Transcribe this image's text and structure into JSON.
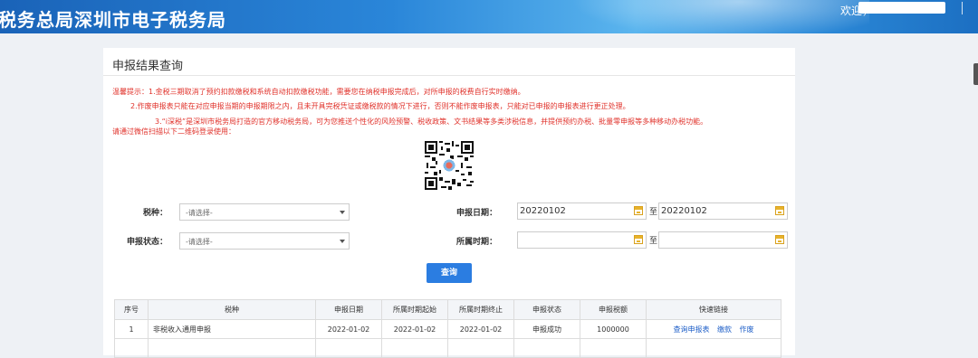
{
  "header": {
    "title": "税务总局深圳市电子税务局",
    "welcome": "欢迎，"
  },
  "panel": {
    "title": "申报结果查询"
  },
  "tips": {
    "line1": "温馨提示：1.金税三期取消了预约扣款缴税和系统自动扣款缴税功能，需要您在纳税申报完成后，对所申报的税费自行实时缴纳。",
    "line2": "2.作废申报表只能在对应申报当期的申报期限之内，且未开具完税凭证或缴税款的情况下进行，否则不能作废申报表，只能对已申报的申报表进行更正处理。",
    "line3": "3.“i深税”是深圳市税务局打造的官方移动税务局，可为您推送个性化的风险预警、税收政策、文书结果等多类涉税信息，并提供预约办税、批量零申报等多种移动办税功能。",
    "line4": "请通过微信扫描以下二维码登录使用："
  },
  "form": {
    "tax_type_label": "税种：",
    "tax_type_placeholder": "-请选择-",
    "status_label": "申报状态：",
    "status_placeholder": "-请选择-",
    "date_label": "申报日期：",
    "date_from": "20220102",
    "date_to": "20220102",
    "period_label": "所属时期：",
    "period_from": "",
    "period_to": "",
    "to_text": "至",
    "query_button": "查询"
  },
  "table": {
    "columns": [
      "序号",
      "税种",
      "申报日期",
      "所属时期起始",
      "所属时期终止",
      "申报状态",
      "申报税额",
      "快速链接"
    ],
    "rows": [
      {
        "index": "1",
        "tax": "非税收入通用申报",
        "date": "2022-01-02",
        "start": "2022-01-02",
        "end": "2022-01-02",
        "status": "申报成功",
        "amount": "1000000",
        "links": [
          "查询申报表",
          "缴款",
          "作废"
        ]
      }
    ]
  },
  "colors": {
    "header_blue": "#2a86d9",
    "tip_red": "#e0312a",
    "button_blue": "#2b7de1",
    "link_blue": "#2060c8"
  }
}
